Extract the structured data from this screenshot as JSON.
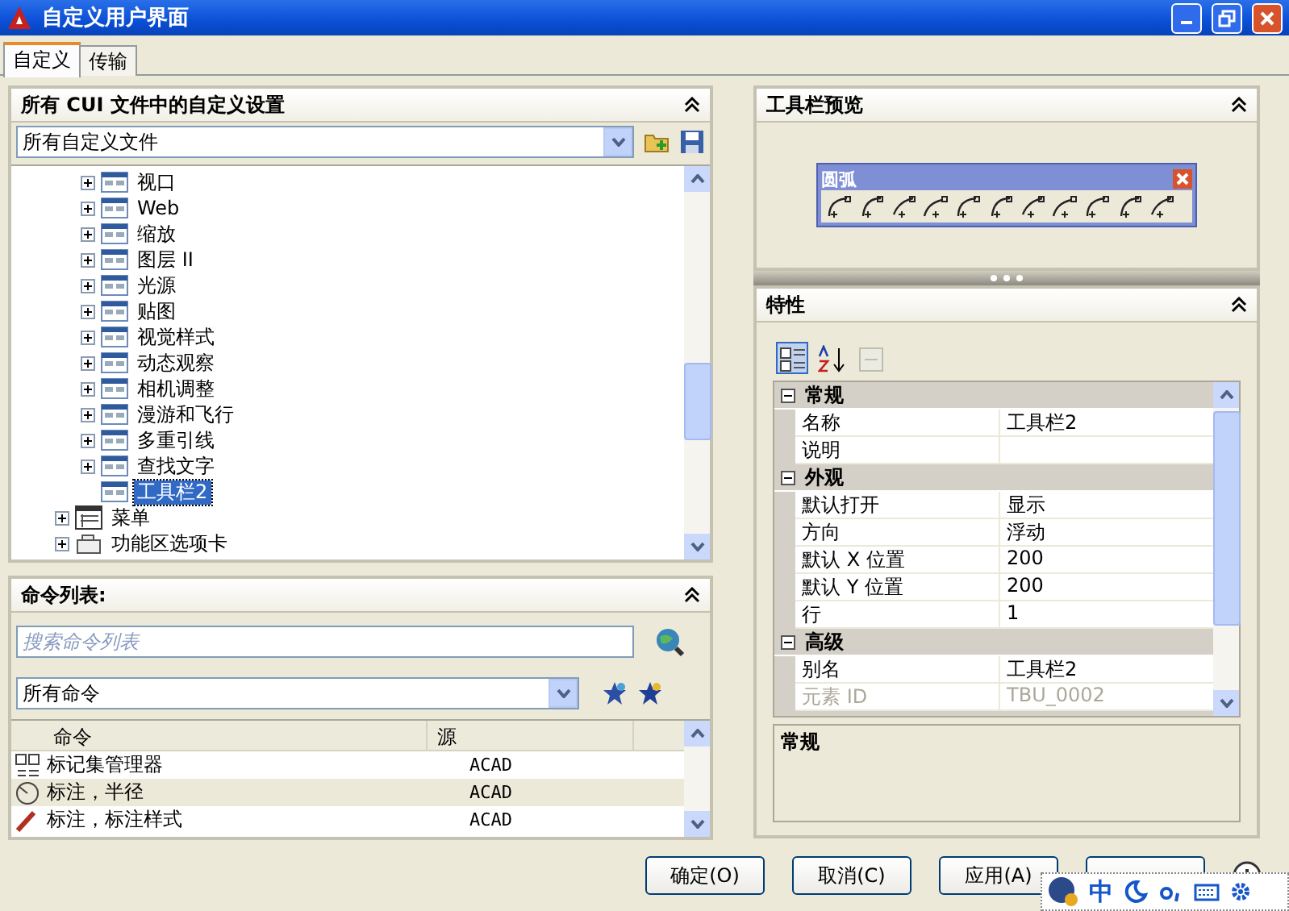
{
  "window": {
    "title": "自定义用户界面"
  },
  "tabs": [
    {
      "label": "自定义",
      "selected": true
    },
    {
      "label": "传输",
      "selected": false
    }
  ],
  "customizations_panel": {
    "title": "所有 CUI 文件中的自定义设置",
    "file_select": "所有自定义文件",
    "tree": [
      {
        "children": [
          {
            "label": "视口",
            "kind": "toolbar",
            "leaf": false,
            "selected": false
          },
          {
            "label": "Web",
            "kind": "toolbar",
            "leaf": false,
            "selected": false
          },
          {
            "label": "缩放",
            "kind": "toolbar",
            "leaf": false,
            "selected": false
          },
          {
            "label": "图层 II",
            "kind": "toolbar",
            "leaf": false,
            "selected": false
          },
          {
            "label": "光源",
            "kind": "toolbar",
            "leaf": false,
            "selected": false
          },
          {
            "label": "贴图",
            "kind": "toolbar",
            "leaf": false,
            "selected": false
          },
          {
            "label": "视觉样式",
            "kind": "toolbar",
            "leaf": false,
            "selected": false
          },
          {
            "label": "动态观察",
            "kind": "toolbar",
            "leaf": false,
            "selected": false
          },
          {
            "label": "相机调整",
            "kind": "toolbar",
            "leaf": false,
            "selected": false
          },
          {
            "label": "漫游和飞行",
            "kind": "toolbar",
            "leaf": false,
            "selected": false
          },
          {
            "label": "多重引线",
            "kind": "toolbar",
            "leaf": false,
            "selected": false
          },
          {
            "label": "查找文字",
            "kind": "toolbar",
            "leaf": false,
            "selected": false
          },
          {
            "label": "工具栏2",
            "kind": "toolbar",
            "leaf": true,
            "selected": true
          }
        ]
      },
      {
        "label": "菜单",
        "kind": "menu",
        "leaf": false,
        "selected": false
      },
      {
        "label": "功能区选项卡",
        "kind": "ribbon",
        "leaf": false,
        "selected": false
      }
    ]
  },
  "command_panel": {
    "title": "命令列表:",
    "search": {
      "placeholder": "搜索命令列表"
    },
    "filter_select": "所有命令",
    "columns": [
      "命令",
      "源"
    ],
    "rows": [
      {
        "kind": "markup",
        "command": "标记集管理器",
        "source": "ACAD"
      },
      {
        "kind": "radius",
        "command": "标注，半径",
        "source": "ACAD"
      },
      {
        "kind": "style",
        "command": "标注，标注样式",
        "source": "ACAD"
      }
    ]
  },
  "preview_panel": {
    "title": "工具栏预览",
    "toolbar_title": "圆弧"
  },
  "properties_panel": {
    "title": "特性",
    "tools": [
      {
        "kind": "categorized",
        "selected": true,
        "disabled": false
      },
      {
        "kind": "alphabetical",
        "selected": false,
        "disabled": false
      },
      {
        "kind": "pages",
        "selected": false,
        "disabled": true
      }
    ],
    "sections": [
      {
        "title": "常规",
        "expanded": true,
        "rows": [
          {
            "name": "名称",
            "value": "工具栏2",
            "disabled": false
          },
          {
            "name": "说明",
            "value": "",
            "disabled": false
          }
        ]
      },
      {
        "title": "外观",
        "expanded": true,
        "rows": [
          {
            "name": "默认打开",
            "value": "显示",
            "disabled": false
          },
          {
            "name": "方向",
            "value": "浮动",
            "disabled": false
          },
          {
            "name": "默认 X 位置",
            "value": "200",
            "disabled": false
          },
          {
            "name": "默认 Y 位置",
            "value": "200",
            "disabled": false
          },
          {
            "name": "行",
            "value": "1",
            "disabled": false
          }
        ]
      },
      {
        "title": "高级",
        "expanded": true,
        "rows": [
          {
            "name": "别名",
            "value": "工具栏2",
            "disabled": false
          },
          {
            "name": "元素 ID",
            "value": "TBU_0002",
            "disabled": true
          }
        ]
      }
    ],
    "description_title": "常规"
  },
  "buttons": [
    {
      "label": "确定(O)"
    },
    {
      "label": "取消(C)"
    },
    {
      "label": "应用(A)"
    }
  ],
  "ime_bar": {
    "mode": "中"
  }
}
